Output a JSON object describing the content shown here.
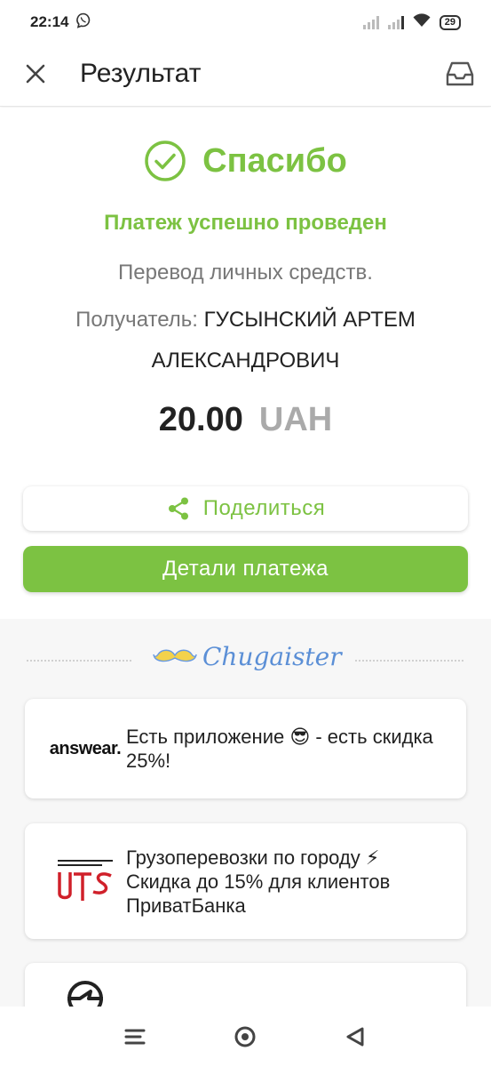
{
  "status_bar": {
    "time": "22:14",
    "battery": "29"
  },
  "header": {
    "title": "Результат"
  },
  "result": {
    "thanks": "Спасибо",
    "success_message": "Платеж успешно проведен",
    "description": "Перевод личных средств.",
    "recipient_label": "Получатель:",
    "recipient_name": "ГУСЫНСКИЙ АРТЕМ АЛЕКСАНДРОВИЧ",
    "amount": "20.00",
    "currency": "UAH",
    "accent_color": "#7cc242"
  },
  "actions": {
    "share_label": "Поделиться",
    "details_label": "Детали платежа"
  },
  "promo": {
    "brand": "Chugaister",
    "offers": [
      {
        "logo": "answear.",
        "text": "Есть приложение 😎 - есть скидка 25%!"
      },
      {
        "logo": "UTS transport company",
        "text": "Грузоперевозки по городу ⚡ Скидка до 15% для клиентов ПриватБанка"
      },
      {
        "logo": "Opel",
        "text": ""
      }
    ]
  },
  "icons": {
    "close": "close-icon",
    "inbox": "inbox-icon",
    "check": "check-circle-icon",
    "share": "share-icon",
    "nav": [
      "menu-icon",
      "home-icon",
      "back-icon"
    ]
  }
}
